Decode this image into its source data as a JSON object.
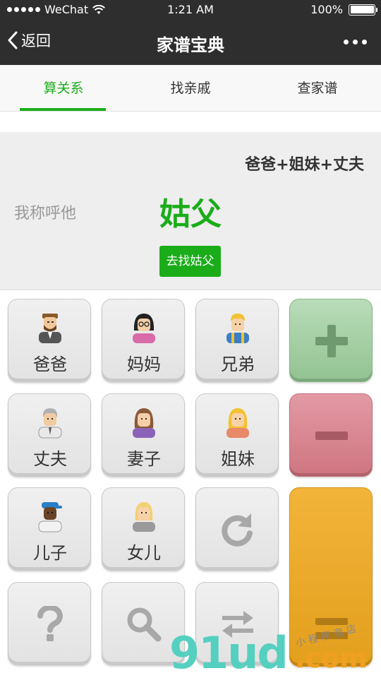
{
  "status_bar": {
    "carrier": "WeChat",
    "time": "1:21 AM",
    "battery": "100%",
    "battery_level": 1.0
  },
  "nav": {
    "back_label": "返回",
    "title": "家谱宝典",
    "more_icon": "more-dots-icon"
  },
  "tabs": [
    {
      "label": "算关系",
      "active": true
    },
    {
      "label": "找亲戚",
      "active": false
    },
    {
      "label": "查家谱",
      "active": false
    }
  ],
  "result_panel": {
    "expression": "爸爸+姐妹+丈夫",
    "call_label": "我称呼他",
    "result": "姑父",
    "find_button": "去找姑父"
  },
  "keypad": {
    "relations": [
      {
        "label": "爸爸",
        "icon": "father-avatar-icon"
      },
      {
        "label": "妈妈",
        "icon": "mother-avatar-icon"
      },
      {
        "label": "兄弟",
        "icon": "brother-avatar-icon"
      },
      {
        "label": "丈夫",
        "icon": "husband-avatar-icon"
      },
      {
        "label": "妻子",
        "icon": "wife-avatar-icon"
      },
      {
        "label": "姐妹",
        "icon": "sister-avatar-icon"
      },
      {
        "label": "儿子",
        "icon": "son-avatar-icon"
      },
      {
        "label": "女儿",
        "icon": "daughter-avatar-icon"
      }
    ],
    "operators": {
      "plus": "plus-icon",
      "minus": "minus-icon",
      "equals": "equals-icon",
      "undo": "undo-icon",
      "help": "question-icon",
      "search": "search-icon",
      "swap": "swap-icon"
    },
    "colors": {
      "accent": "#1aad19",
      "plus": "#a6cfa6",
      "minus": "#d9848f",
      "equals": "#e9a526"
    }
  },
  "watermark": {
    "main": "91ud",
    "suffix": ".com",
    "small": "小 程 序 商 店"
  }
}
